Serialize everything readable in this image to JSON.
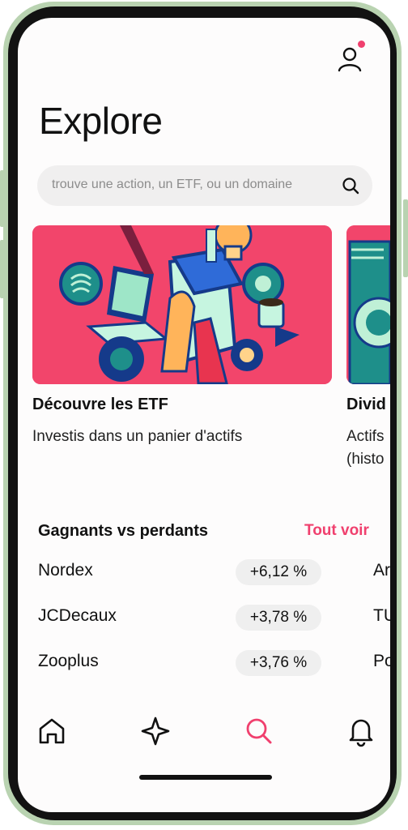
{
  "header": {
    "title": "Explore"
  },
  "search": {
    "placeholder": "trouve une action, un ETF, ou un domaine"
  },
  "cards": [
    {
      "title": "Découvre les ETF",
      "subtitle": "Investis dans un panier d'actifs"
    },
    {
      "title": "Divid",
      "subtitle_lines": [
        "Actifs",
        "(histo"
      ]
    }
  ],
  "movers": {
    "title": "Gagnants vs perdants",
    "see_all": "Tout voir",
    "rows": [
      {
        "name": "Nordex",
        "change": "+6,12 %",
        "next": "Ar"
      },
      {
        "name": "JCDecaux",
        "change": "+3,78 %",
        "next": "TU"
      },
      {
        "name": "Zooplus",
        "change": "+3,76 %",
        "next": "Po"
      }
    ]
  },
  "nav": {
    "items": [
      {
        "icon": "home-icon",
        "active": false
      },
      {
        "icon": "sparkle-icon",
        "active": false
      },
      {
        "icon": "search-icon",
        "active": true
      },
      {
        "icon": "bell-icon",
        "active": false
      }
    ]
  },
  "colors": {
    "accent": "#f0406e",
    "card_bg": "#f2456b",
    "frame": "#b9d3b1"
  }
}
